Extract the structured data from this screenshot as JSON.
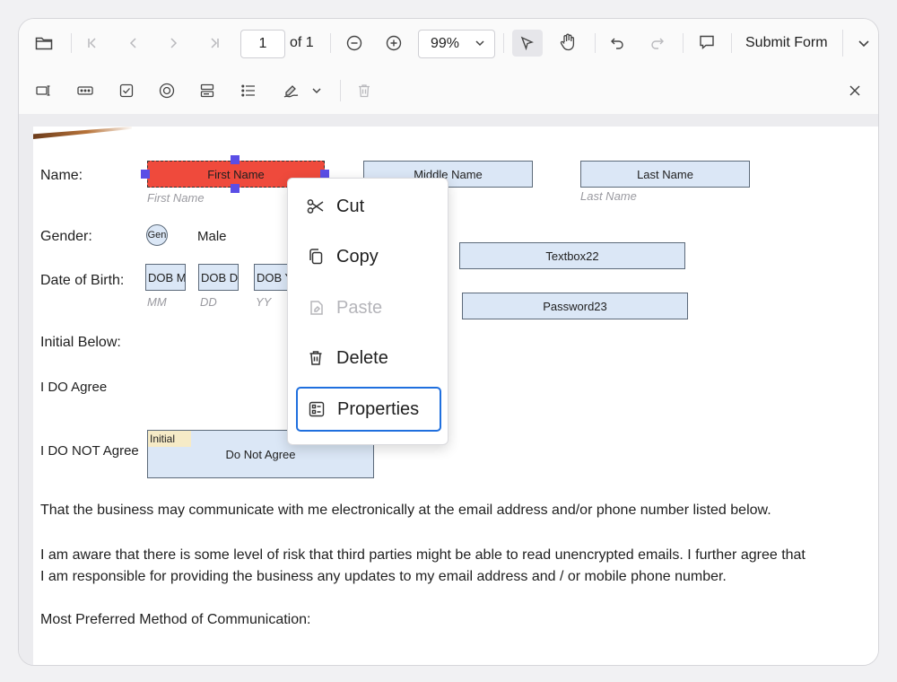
{
  "toolbar": {
    "page_current": "1",
    "page_total": "of 1",
    "zoom": "99%",
    "submit_label": "Submit Form"
  },
  "form": {
    "name_label": "Name:",
    "first_name": "First Name",
    "first_name_hint": "First Name",
    "middle_name": "Middle Name",
    "last_name": "Last Name",
    "last_name_hint": "Last Name",
    "gender_label": "Gender:",
    "gender_radio": "Gen",
    "male_label": "Male",
    "dob_label": "Date of Birth:",
    "dob_month": "DOB Mo",
    "dob_day": "DOB Da",
    "dob_year": "DOB Y",
    "mm": "MM",
    "dd": "DD",
    "yy": "YY",
    "textbox22": "Textbox22",
    "password23": "Password23",
    "initial_below": "Initial Below:",
    "i_do_agree": "I DO Agree",
    "i_do_not_agree": "I DO NOT Agree",
    "initial_tag": "Initial",
    "do_not_agree": "Do Not Agree",
    "para1": "That the business may communicate with me electronically at the email address and/or phone number listed below.",
    "para2_line1": "I am aware that there is some level of risk that third parties might be able to read unencrypted emails. I further agree that",
    "para2_line2": "I am responsible for providing the business any updates to my email address and / or mobile phone number.",
    "para3": "Most Preferred Method of Communication:"
  },
  "context_menu": {
    "items": [
      {
        "label": "Cut",
        "icon": "scissors-icon",
        "enabled": true
      },
      {
        "label": "Copy",
        "icon": "copy-icon",
        "enabled": true
      },
      {
        "label": "Paste",
        "icon": "paste-icon",
        "enabled": false
      },
      {
        "label": "Delete",
        "icon": "trash-icon",
        "enabled": true
      },
      {
        "label": "Properties",
        "icon": "properties-icon",
        "enabled": true,
        "focused": true
      }
    ]
  },
  "colors": {
    "accent": "#1f6fde",
    "field_bg": "#dbe7f6",
    "selected_field": "#ef4a3c",
    "handle": "#5a4ee6"
  }
}
